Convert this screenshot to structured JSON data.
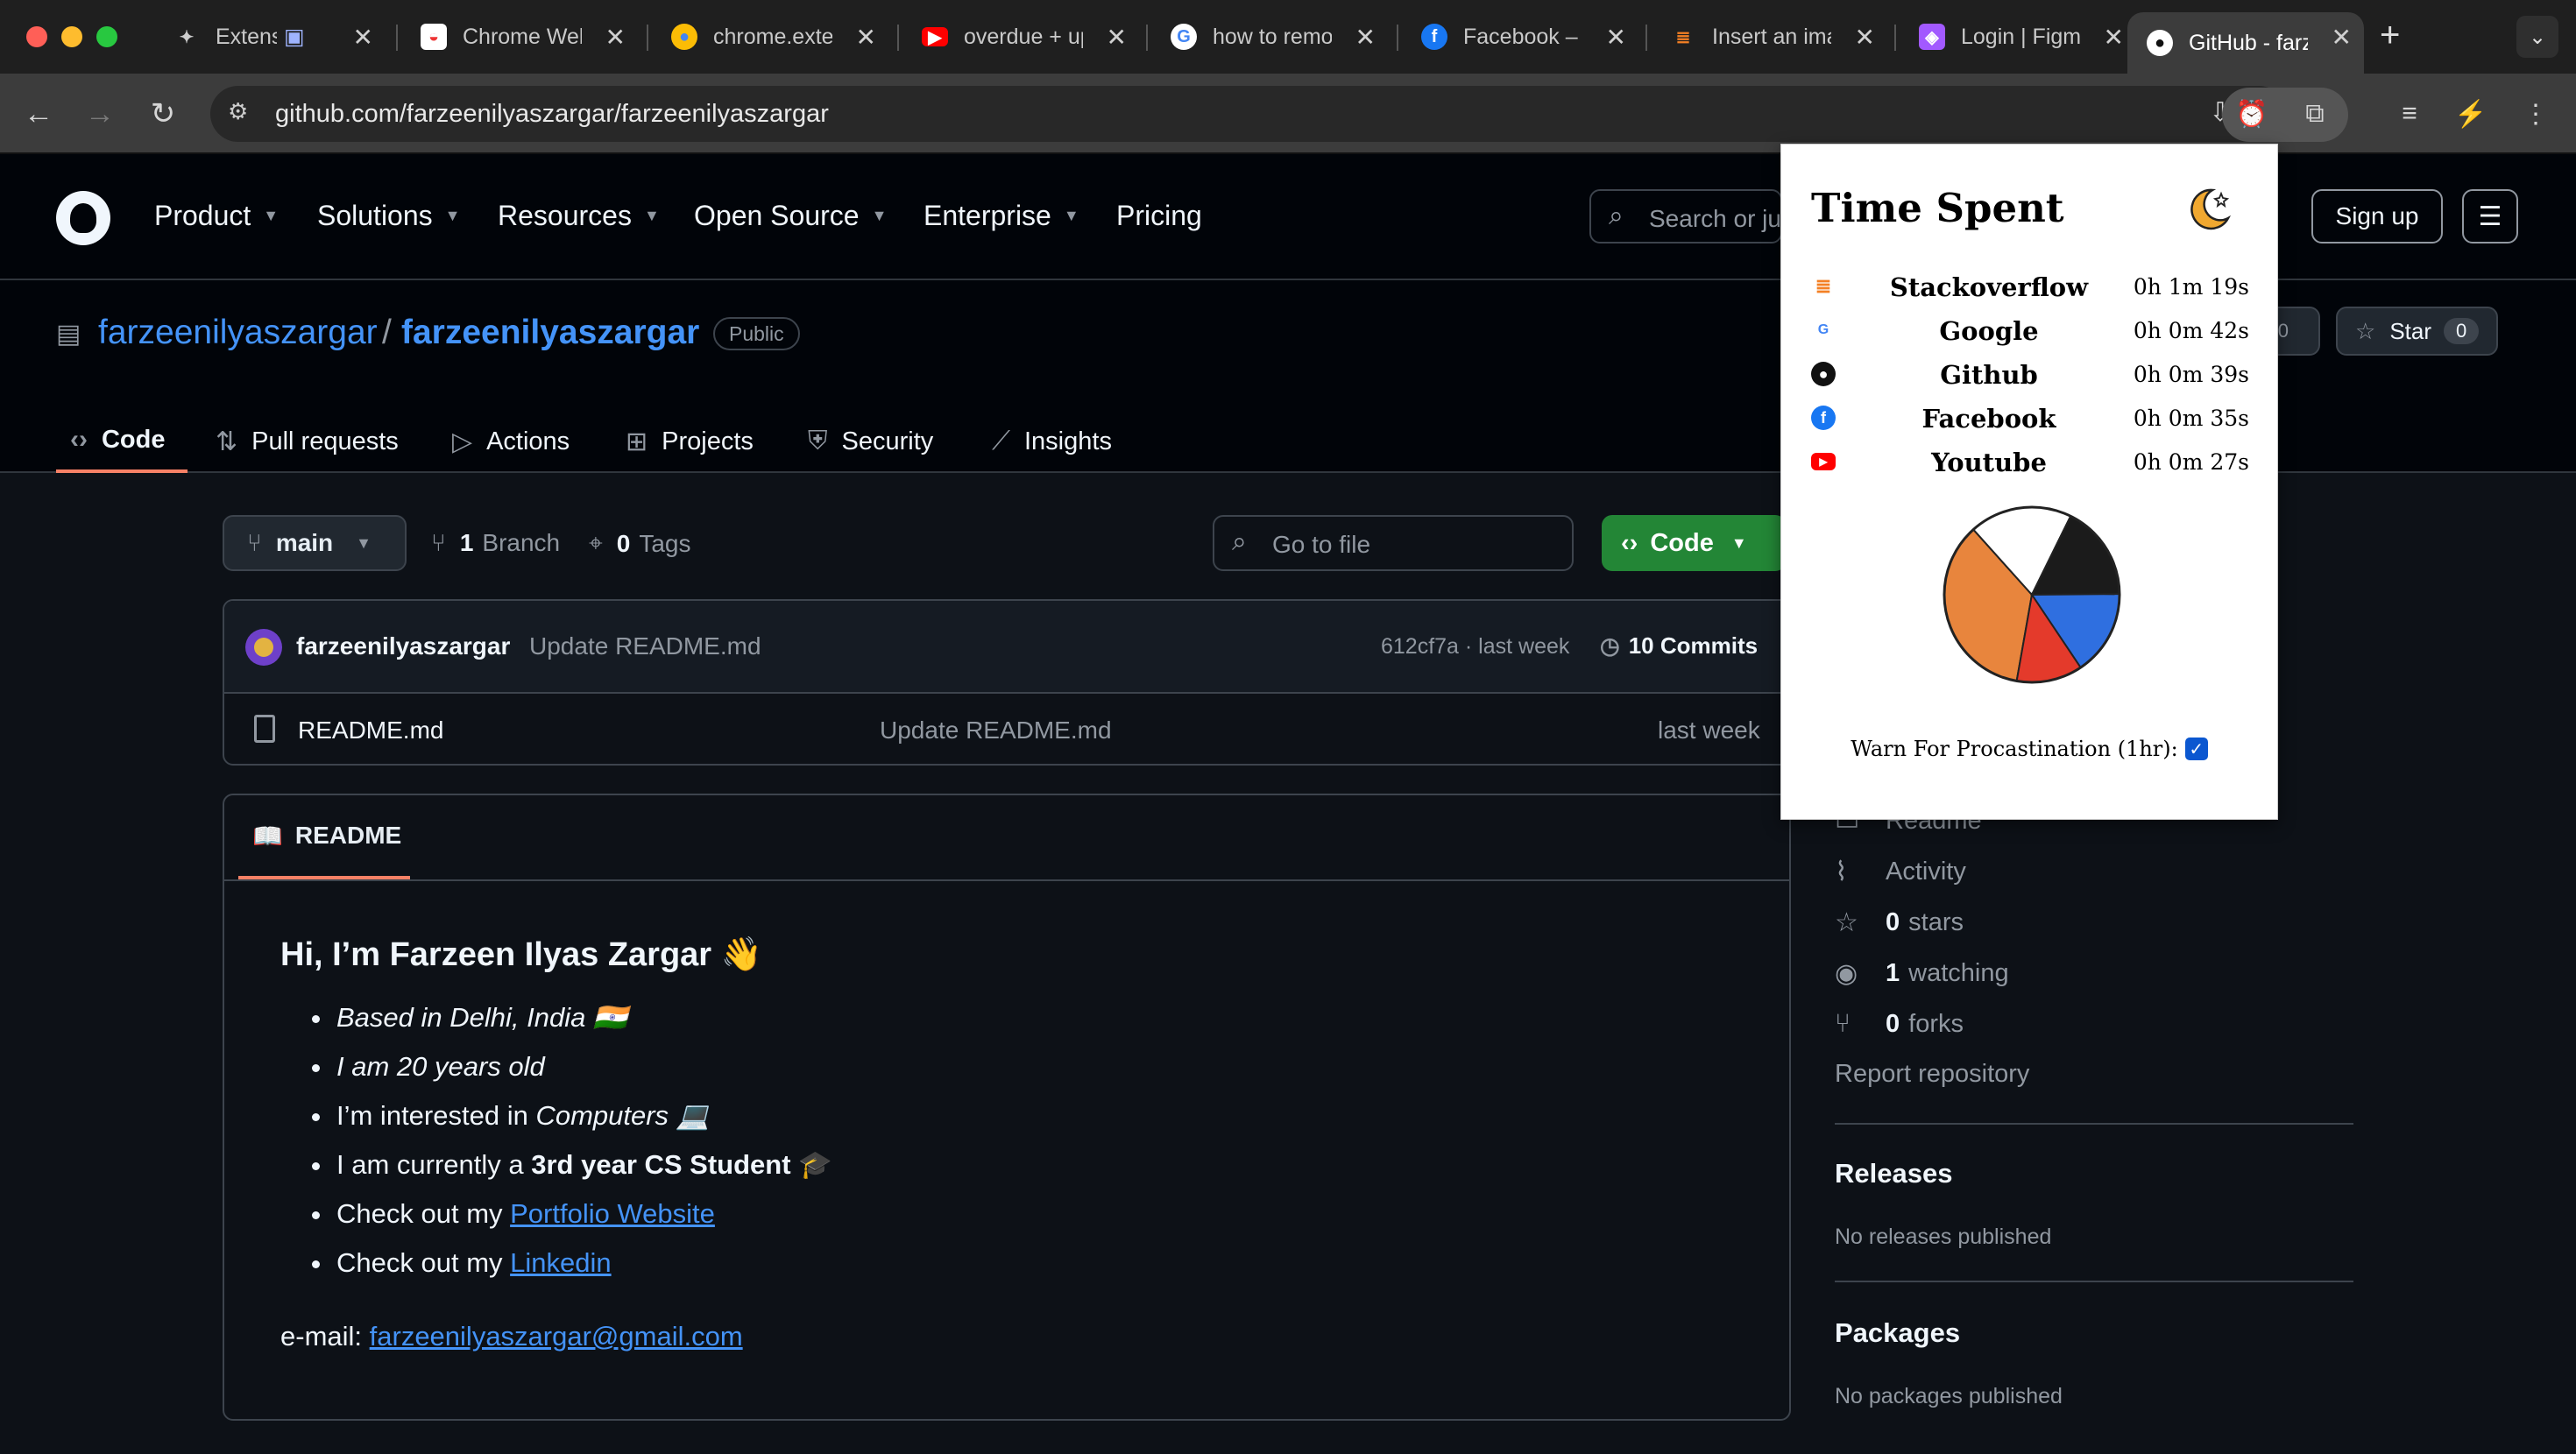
{
  "browser": {
    "tabs": [
      {
        "title": "Extensions",
        "icon": "puzzle-icon"
      },
      {
        "title": "Chrome Web Store",
        "icon": "webstore-icon"
      },
      {
        "title": "chrome.extension",
        "icon": "chrome-icon"
      },
      {
        "title": "overdue + update",
        "icon": "youtube-icon"
      },
      {
        "title": "how to remove",
        "icon": "google-icon"
      },
      {
        "title": "Facebook – log in",
        "icon": "facebook-icon"
      },
      {
        "title": "Insert an image",
        "icon": "stackoverflow-icon"
      },
      {
        "title": "Login | Figma",
        "icon": "figma-icon"
      },
      {
        "title": "GitHub - farzeenilyaszargar",
        "icon": "github-icon"
      }
    ],
    "url": "github.com/farzeenilyaszargar/farzeenilyaszargar"
  },
  "gh_header": {
    "nav": [
      "Product",
      "Solutions",
      "Resources",
      "Open Source",
      "Enterprise",
      "Pricing"
    ],
    "search_placeholder": "Search or jump to...",
    "signup_label": "Sign up"
  },
  "repo": {
    "owner": "farzeenilyaszargar",
    "name": "farzeenilyaszargar",
    "visibility": "Public",
    "fork_count": "0",
    "star_label": "Star",
    "star_count": "0",
    "tabs": [
      "Code",
      "Pull requests",
      "Actions",
      "Projects",
      "Security",
      "Insights"
    ]
  },
  "main": {
    "branch": "main",
    "branches_count": "1",
    "branches_label": "Branch",
    "tags_count": "0",
    "tags_label": "Tags",
    "goto_placeholder": "Go to file",
    "code_label": "Code",
    "commit": {
      "user": "farzeenilyaszargar",
      "message": "Update README.md",
      "hash": "612cf7a · last week",
      "commits_count": "10 Commits"
    },
    "files": [
      {
        "name": "README.md",
        "message": "Update README.md",
        "date": "last week"
      }
    ]
  },
  "readme": {
    "tab_label": "README",
    "heading": "Hi, I’m Farzeen Ilyas Zargar 👋",
    "items": [
      {
        "text": "Based in Delhi, India 🇮🇳"
      },
      {
        "text": "I am 20 years old"
      },
      {
        "prefix": "I’m interested in ",
        "em": "Computers 💻"
      },
      {
        "prefix": "I am currently a ",
        "strong": "3rd year CS Student",
        "suffix": " 🎓"
      },
      {
        "prefix": "Check out my ",
        "link": "Portfolio Website"
      },
      {
        "prefix": "Check out my ",
        "link": "Linkedin"
      }
    ],
    "email_label": "e-mail: ",
    "email": "farzeenilyaszargar@gmail.com"
  },
  "sidebar": {
    "readme": "Readme",
    "activity": "Activity",
    "stars_count": "0",
    "stars_label": "stars",
    "watching_count": "1",
    "watching_label": "watching",
    "forks_count": "0",
    "forks_label": "forks",
    "report": "Report repository",
    "releases_h": "Releases",
    "releases_sub": "No releases published",
    "packages_h": "Packages",
    "packages_sub": "No packages published"
  },
  "popup": {
    "title": "Time Spent",
    "sites": [
      {
        "name": "Stackoverflow",
        "time": "0h 1m 19s",
        "icon": "stackoverflow-icon"
      },
      {
        "name": "Google",
        "time": "0h 0m 42s",
        "icon": "google-icon"
      },
      {
        "name": "Github",
        "time": "0h 0m 39s",
        "icon": "github-icon"
      },
      {
        "name": "Facebook",
        "time": "0h 0m 35s",
        "icon": "facebook-icon"
      },
      {
        "name": "Youtube",
        "time": "0h 0m 27s",
        "icon": "youtube-icon"
      }
    ],
    "warn_label": "Warn For Procastination (1hr):",
    "warn_checked": true
  },
  "chart_data": {
    "type": "pie",
    "categories": [
      "Stackoverflow",
      "Google",
      "Github",
      "Facebook",
      "Youtube"
    ],
    "values": [
      79,
      42,
      39,
      35,
      27
    ],
    "unit": "seconds",
    "colors": [
      "#e8853d",
      "#ffffff",
      "#1b1b1b",
      "#2f6fe0",
      "#e43a2b"
    ]
  }
}
